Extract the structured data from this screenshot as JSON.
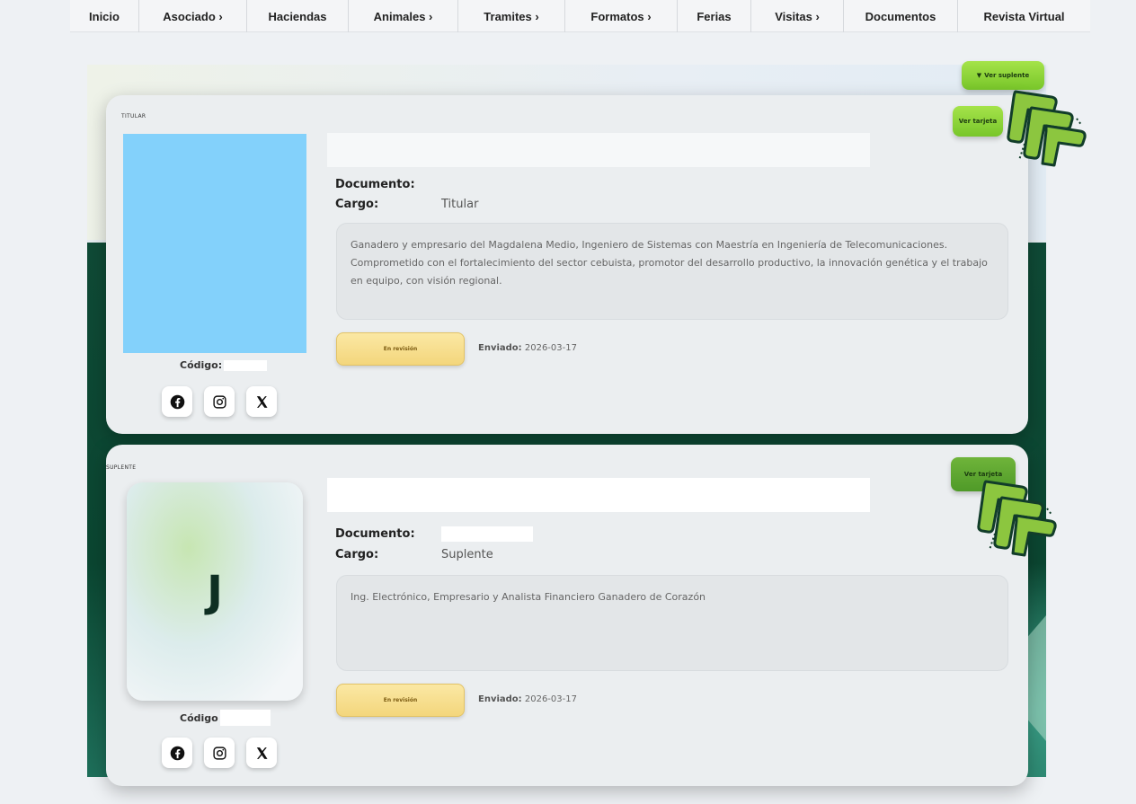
{
  "nav": {
    "items": [
      "Inicio",
      "Asociado ›",
      "Haciendas",
      "Animales ›",
      "Tramites ›",
      "Formatos ›",
      "Ferias",
      "Visitas ›",
      "Documentos",
      "Revista Virtual"
    ]
  },
  "toggle": {
    "label": "Ver suplente",
    "icon": "caret-down-icon"
  },
  "titular": {
    "tag": "TITULAR",
    "codigo_label": "Código:",
    "documento_label": "Documento:",
    "cargo_label": "Cargo:",
    "cargo_value": "Titular",
    "bio": "Ganadero y empresario del Magdalena Medio, Ingeniero de Sistemas con Maestría en Ingeniería de Telecomunicaciones. Comprometido con el fortalecimiento del sector cebuista, promotor del desarrollo productivo, la innovación genética y el trabajo en equipo, con visión regional.",
    "status": "En revisión",
    "enviado_label": "Enviado:",
    "enviado_value": "2026-03-17",
    "ver_tarjeta": "Ver tarjeta"
  },
  "suplente": {
    "tag": "SUPLENTE",
    "initial": "J",
    "codigo_label": "Código",
    "documento_label": "Documento:",
    "cargo_label": "Cargo:",
    "cargo_value": "Suplente",
    "bio": "Ing. Electrónico, Empresario y Analista Financiero Ganadero de Corazón",
    "status": "En revisión",
    "enviado_label": "Enviado:",
    "enviado_value": "2026-03-17",
    "ver_tarjeta": "Ver tarjeta"
  },
  "social": [
    "facebook-icon",
    "instagram-icon",
    "x-icon"
  ],
  "colors": {
    "accent_green": "#8fd43a",
    "dark_green": "#0b4631",
    "status_yellow": "#f6dc86",
    "photo_blue": "#83d1fb"
  }
}
